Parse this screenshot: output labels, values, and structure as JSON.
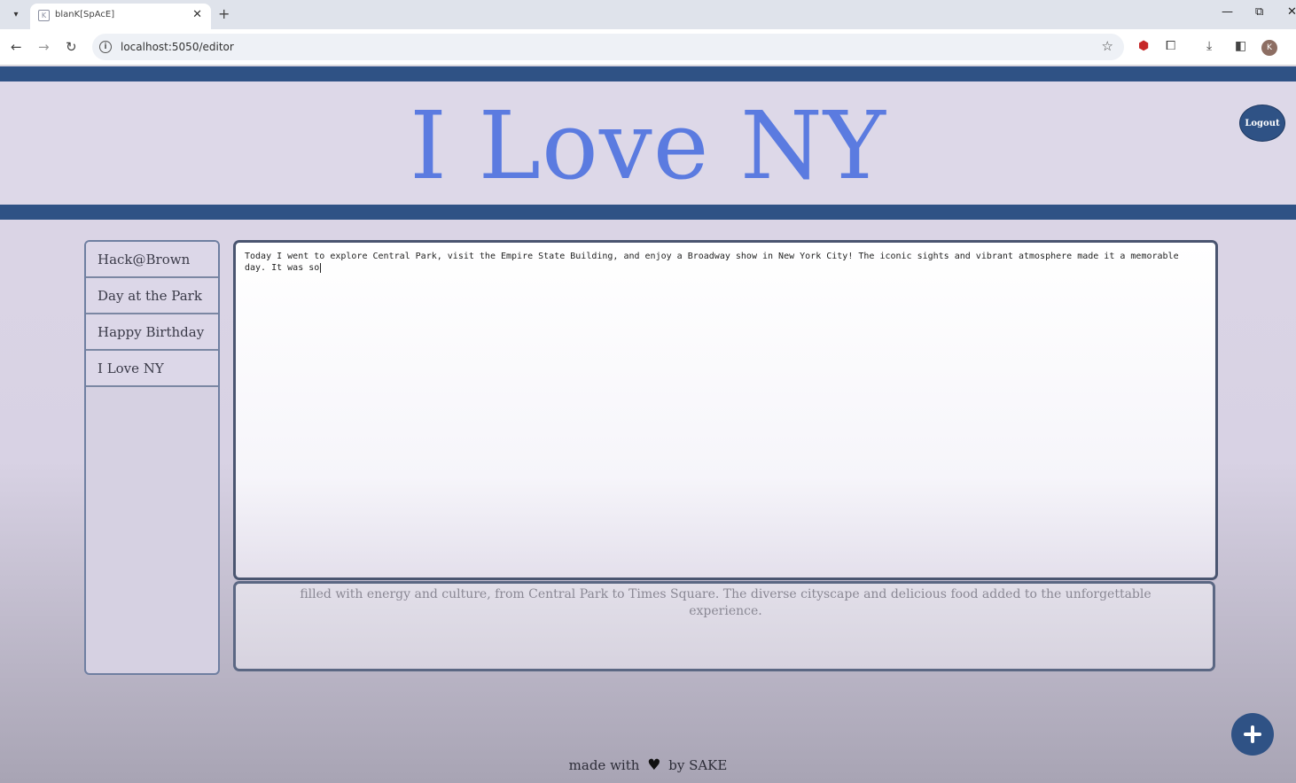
{
  "browser": {
    "tab_title": "blanK[SpAcE]",
    "url": "localhost:5050/editor",
    "profile_initial": "K"
  },
  "header": {
    "title": "I Love NY",
    "logout_label": "Logout"
  },
  "sidebar": {
    "items": [
      {
        "label": "Hack@Brown"
      },
      {
        "label": "Day at the Park"
      },
      {
        "label": "Happy Birthday"
      },
      {
        "label": "I Love NY"
      }
    ]
  },
  "editor": {
    "text": "Today I went to explore Central Park, visit the Empire State Building, and enjoy a Broadway show in New York City! The iconic sights and vibrant atmosphere made it a memorable day. It was so"
  },
  "suggestion": {
    "text": "filled with energy and culture, from Central Park to Times Square. The diverse cityscape and delicious food added to the unforgettable experience."
  },
  "footer": {
    "prefix": "made with",
    "suffix": "by SAKE"
  },
  "colors": {
    "accent": "#2f5285",
    "title": "#5b7be0",
    "background": "#dcd6e6"
  }
}
